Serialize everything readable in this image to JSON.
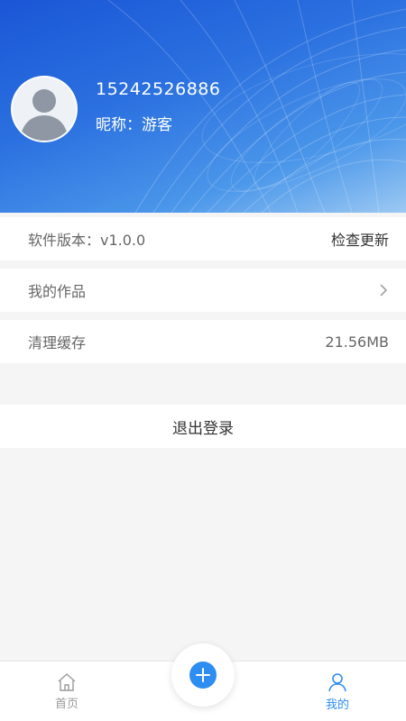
{
  "profile": {
    "phone": "15242526886",
    "nickname": "昵称：游客"
  },
  "settings": {
    "version_label": "软件版本：v1.0.0",
    "check_update": "检查更新",
    "my_works": "我的作品",
    "clear_cache": "清理缓存",
    "cache_size": "21.56MB",
    "logout": "退出登录"
  },
  "nav": {
    "home": "首页",
    "mine": "我的",
    "active": "mine"
  },
  "colors": {
    "accent": "#2d8df0",
    "header_blue": "#2b70e0"
  },
  "icons": {
    "avatar": "default-user-avatar",
    "home": "home-icon",
    "mine": "user-icon",
    "add": "plus-icon",
    "arrow": "chevron-right-icon"
  }
}
